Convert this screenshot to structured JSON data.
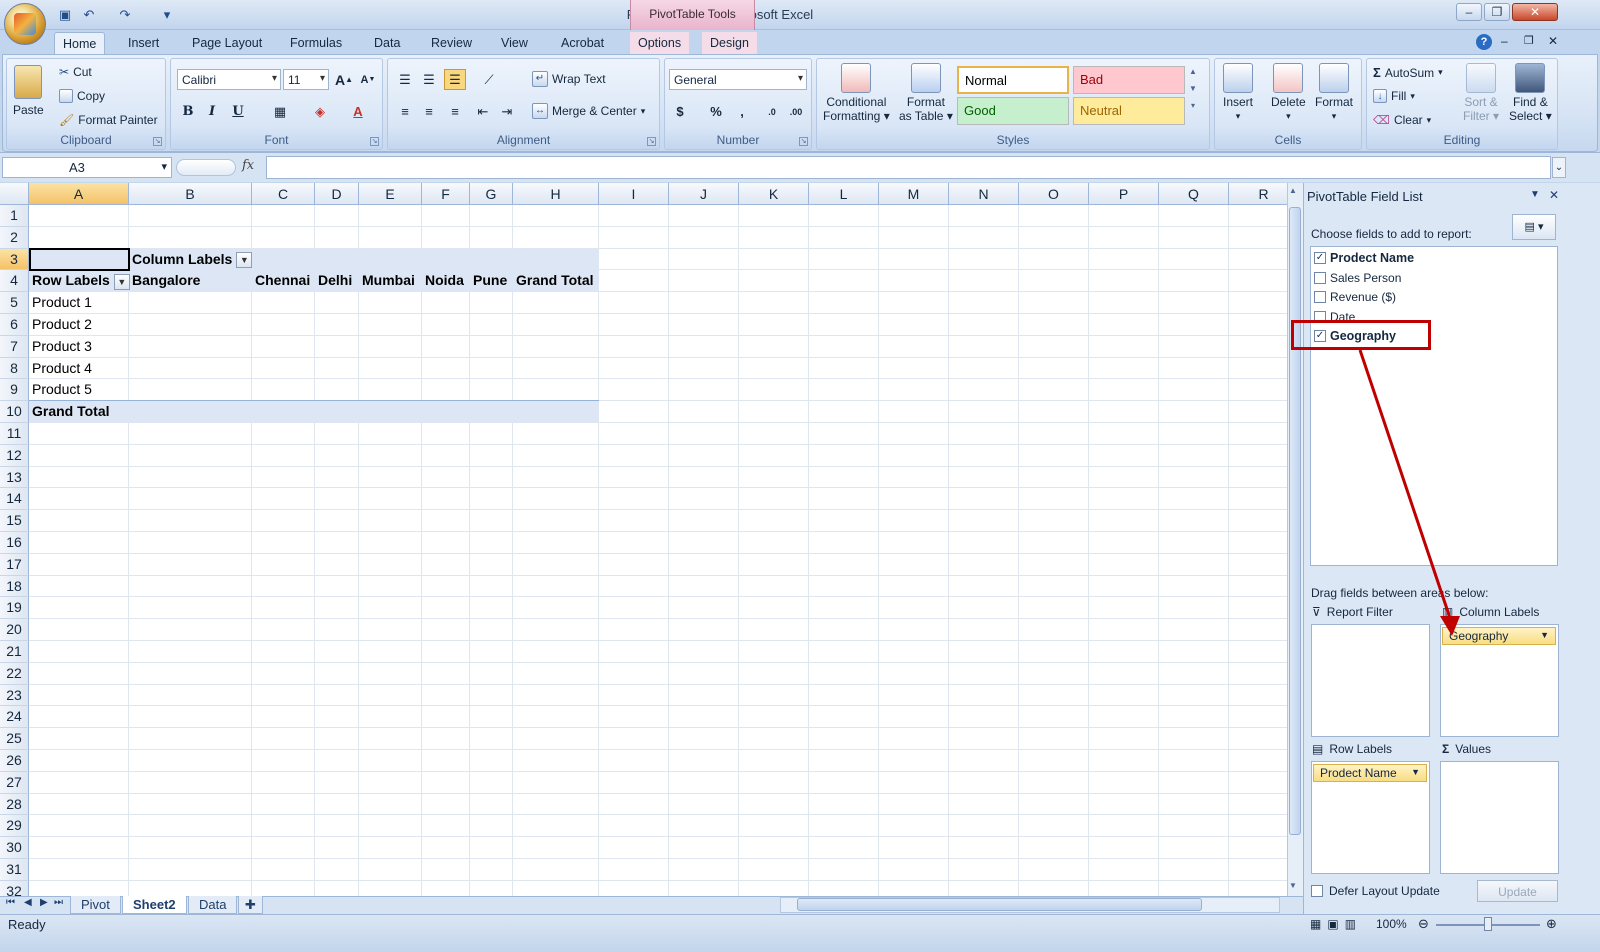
{
  "window": {
    "title": "Pivot table.xlsx - Microsoft Excel",
    "context_tab": "PivotTable Tools"
  },
  "tabs": [
    "Home",
    "Insert",
    "Page Layout",
    "Formulas",
    "Data",
    "Review",
    "View",
    "Acrobat",
    "Options",
    "Design"
  ],
  "ribbon": {
    "clipboard": {
      "label": "Clipboard",
      "paste": "Paste",
      "cut": "Cut",
      "copy": "Copy",
      "format_painter": "Format Painter"
    },
    "font": {
      "label": "Font",
      "name": "Calibri",
      "size": "11",
      "bold": "B",
      "italic": "I",
      "underline": "U",
      "grow": "A",
      "shrink": "A",
      "color_a": "A"
    },
    "alignment": {
      "label": "Alignment",
      "wrap": "Wrap Text",
      "merge": "Merge & Center"
    },
    "number": {
      "label": "Number",
      "format": "General",
      "currency": "$",
      "percent": "%",
      "comma": ",",
      "inc_dec": ".0",
      "dec_dec": ".00"
    },
    "styles": {
      "label": "Styles",
      "cond": "Conditional",
      "cond2": "Formatting",
      "fmt_table": "Format",
      "fmt_table2": "as Table",
      "normal": "Normal",
      "bad": "Bad",
      "good": "Good",
      "neutral": "Neutral"
    },
    "cells": {
      "label": "Cells",
      "insert": "Insert",
      "delete": "Delete",
      "format": "Format"
    },
    "editing": {
      "label": "Editing",
      "autosum": "AutoSum",
      "fill": "Fill",
      "clear": "Clear",
      "sort": "Sort &",
      "sort2": "Filter",
      "find": "Find &",
      "find2": "Select"
    }
  },
  "formula_bar": {
    "name_box": "A3",
    "fx": "fx",
    "value": ""
  },
  "columns": [
    {
      "name": "A",
      "w": 100
    },
    {
      "name": "B",
      "w": 123
    },
    {
      "name": "C",
      "w": 63
    },
    {
      "name": "D",
      "w": 44
    },
    {
      "name": "E",
      "w": 63
    },
    {
      "name": "F",
      "w": 48
    },
    {
      "name": "G",
      "w": 43
    },
    {
      "name": "H",
      "w": 86
    },
    {
      "name": "I",
      "w": 70
    },
    {
      "name": "J",
      "w": 70
    },
    {
      "name": "K",
      "w": 70
    },
    {
      "name": "L",
      "w": 70
    },
    {
      "name": "M",
      "w": 70
    },
    {
      "name": "N",
      "w": 70
    },
    {
      "name": "O",
      "w": 70
    },
    {
      "name": "P",
      "w": 70
    },
    {
      "name": "Q",
      "w": 70
    },
    {
      "name": "R",
      "w": 70
    }
  ],
  "row_count": 32,
  "pivot": {
    "column_labels": "Column Labels",
    "row_labels": "Row Labels",
    "col_headers": [
      "Bangalore",
      "Chennai",
      "Delhi",
      "Mumbai",
      "Noida",
      "Pune",
      "Grand Total"
    ],
    "rows": [
      "Product 1",
      "Product 2",
      "Product 3",
      "Product 4",
      "Product 5"
    ],
    "grand_total": "Grand Total"
  },
  "sheets": [
    "Pivot",
    "Sheet2",
    "Data"
  ],
  "active_sheet": "Sheet2",
  "status": {
    "ready": "Ready",
    "zoom": "100%"
  },
  "field_list": {
    "title": "PivotTable Field List",
    "choose": "Choose fields to add to report:",
    "fields": [
      {
        "name": "Prodect Name",
        "checked": true
      },
      {
        "name": "Sales Person",
        "checked": false
      },
      {
        "name": "Revenue ($)",
        "checked": false
      },
      {
        "name": "Date",
        "checked": false
      },
      {
        "name": "Geography",
        "checked": true
      }
    ],
    "drag_text": "Drag fields between areas below:",
    "report_filter": "Report Filter",
    "column_labels": "Column Labels",
    "row_labels": "Row Labels",
    "values": "Values",
    "column_field": "Geography",
    "row_field": "Prodect Name",
    "defer": "Defer Layout Update",
    "update": "Update"
  }
}
